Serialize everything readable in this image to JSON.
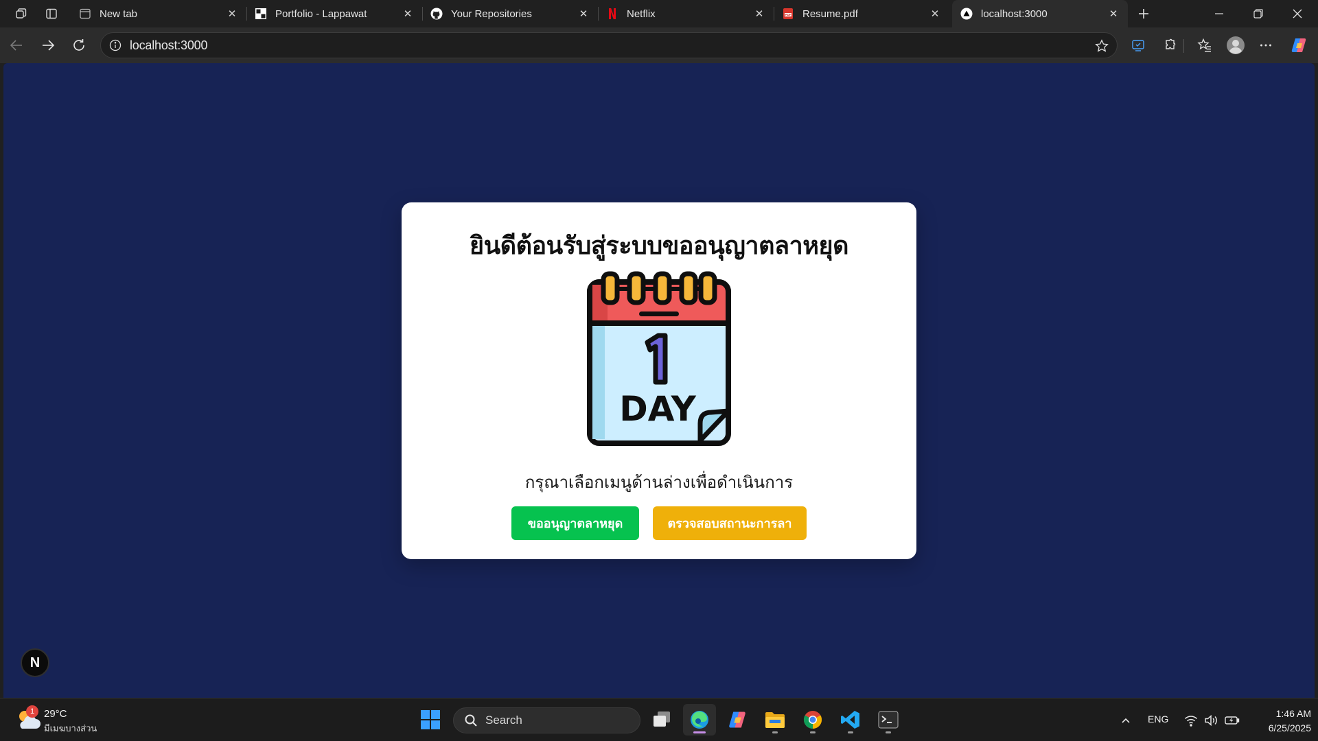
{
  "browser": {
    "tabs": [
      {
        "title": "New tab",
        "icon": "newtab-icon",
        "active": false
      },
      {
        "title": "Portfolio - Lappawat",
        "icon": "portfolio-favicon",
        "active": false
      },
      {
        "title": "Your Repositories",
        "icon": "github-icon",
        "active": false
      },
      {
        "title": "Netflix",
        "icon": "netflix-icon",
        "active": false
      },
      {
        "title": "Resume.pdf",
        "icon": "pdf-icon",
        "active": false
      },
      {
        "title": "localhost:3000",
        "icon": "nextjs-favicon",
        "active": true
      }
    ],
    "address_bar": {
      "url": "localhost:3000"
    }
  },
  "page": {
    "title": "ยินดีต้อนรับสู่ระบบขออนุญาตลาหยุด",
    "illustration": {
      "icon": "calendar-one-day-icon",
      "number": "1",
      "label": "DAY"
    },
    "subtitle": "กรุณาเลือกเมนูด้านล่างเพื่อดำเนินการ",
    "buttons": {
      "request_leave": "ขออนุญาตลาหยุด",
      "check_status": "ตรวจสอบสถานะการลา"
    },
    "dev_badge": "N",
    "colors": {
      "background": "#172355",
      "card": "#ffffff",
      "primary_button": "#06c24f",
      "secondary_button": "#efb00a"
    }
  },
  "taskbar": {
    "weather": {
      "temp": "29°C",
      "desc": "มีเมฆบางส่วน",
      "badge": "1"
    },
    "search_placeholder": "Search",
    "language": "ENG",
    "time": "1:46 AM",
    "date": "6/25/2025"
  }
}
